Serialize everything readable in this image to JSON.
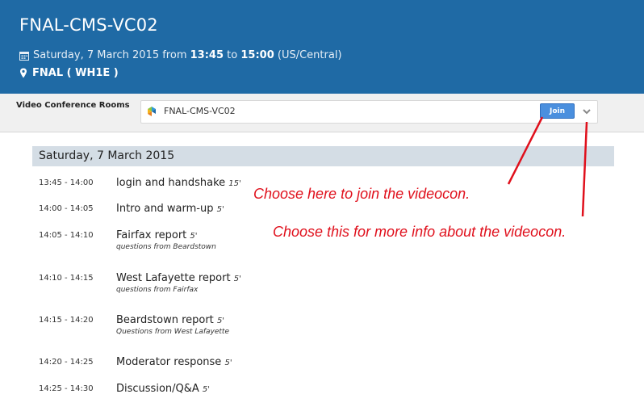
{
  "header": {
    "title": "FNAL-CMS-VC02",
    "date_prefix": "Saturday, 7 March 2015 from",
    "start": "13:45",
    "to": "to",
    "end": "15:00",
    "timezone": "(US/Central)",
    "location": "FNAL ( WH1E )"
  },
  "vc": {
    "label": "Video Conference Rooms",
    "room_name": "FNAL-CMS-VC02",
    "join_label": "Join"
  },
  "agenda": {
    "day": "Saturday, 7 March 2015",
    "items": [
      {
        "time": "13:45 - 14:00",
        "title": "login and handshake",
        "duration": "15'",
        "note": ""
      },
      {
        "time": "14:00 - 14:05",
        "title": "Intro and warm-up",
        "duration": "5'",
        "note": ""
      },
      {
        "time": "14:05 - 14:10",
        "title": "Fairfax report",
        "duration": "5'",
        "note": "questions from Beardstown"
      },
      {
        "time": "14:10 - 14:15",
        "title": "West Lafayette report",
        "duration": "5'",
        "note": "questions from Fairfax"
      },
      {
        "time": "14:15 - 14:20",
        "title": "Beardstown report",
        "duration": "5'",
        "note": "Questions from West Lafayette"
      },
      {
        "time": "14:20 - 14:25",
        "title": "Moderator response",
        "duration": "5'",
        "note": ""
      },
      {
        "time": "14:25 - 14:30",
        "title": "Discussion/Q&A",
        "duration": "5'",
        "note": ""
      }
    ]
  },
  "annotations": {
    "join_hint": "Choose here to join the videocon.",
    "more_hint": "Choose this for more info about the videocon."
  },
  "colors": {
    "header_bg": "#1f6aa5",
    "join_button": "#4a8fde",
    "annotation": "#e0101c",
    "day_header_bg": "#d4dde5"
  }
}
